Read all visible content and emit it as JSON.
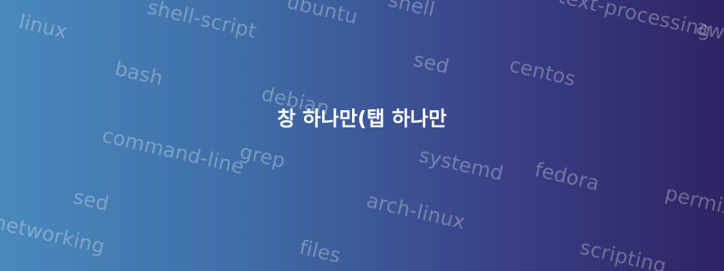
{
  "title": "창 하나만(탭 하나만",
  "tags": {
    "linux": "linux",
    "shell_script": "shell-script",
    "ubuntu": "ubuntu",
    "shell": "shell",
    "text_processing": "text-processing",
    "awk": "awk",
    "bash": "bash",
    "sed_top": "sed",
    "debian": "debian",
    "centos": "centos",
    "command_line": "command-line",
    "grep": "grep",
    "systemd": "systemd",
    "fedora": "fedora",
    "sed": "sed",
    "arch_linux": "arch-linux",
    "permissions": "permissions",
    "networking": "networking",
    "files": "files",
    "scripting": "scripting"
  }
}
